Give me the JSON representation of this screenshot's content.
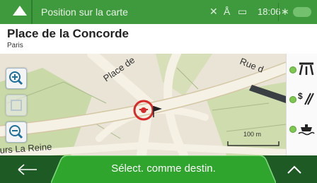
{
  "header": {
    "title": "Position sur la carte",
    "time": "18:06",
    "status_icons": [
      "satellite-icon",
      "person-icon",
      "battery-icon",
      "bluetooth-icon",
      "chat-bubble-icon"
    ]
  },
  "place": {
    "name": "Place de la Concorde",
    "city": "Paris"
  },
  "map": {
    "street_labels": [
      "Place de",
      "Rue d",
      "urs La Reine"
    ],
    "scale": "100 m"
  },
  "sidebar": {
    "items": [
      "highway-icon",
      "toll-road-icon",
      "ferry-icon"
    ]
  },
  "footer": {
    "select_label": "Sélect. comme destin."
  },
  "colors": {
    "top_bar": "#3f9a3d",
    "bottom_bar": "#1e5a24",
    "primary_button": "#2fa52e",
    "map_background": "#e9e4d6"
  }
}
